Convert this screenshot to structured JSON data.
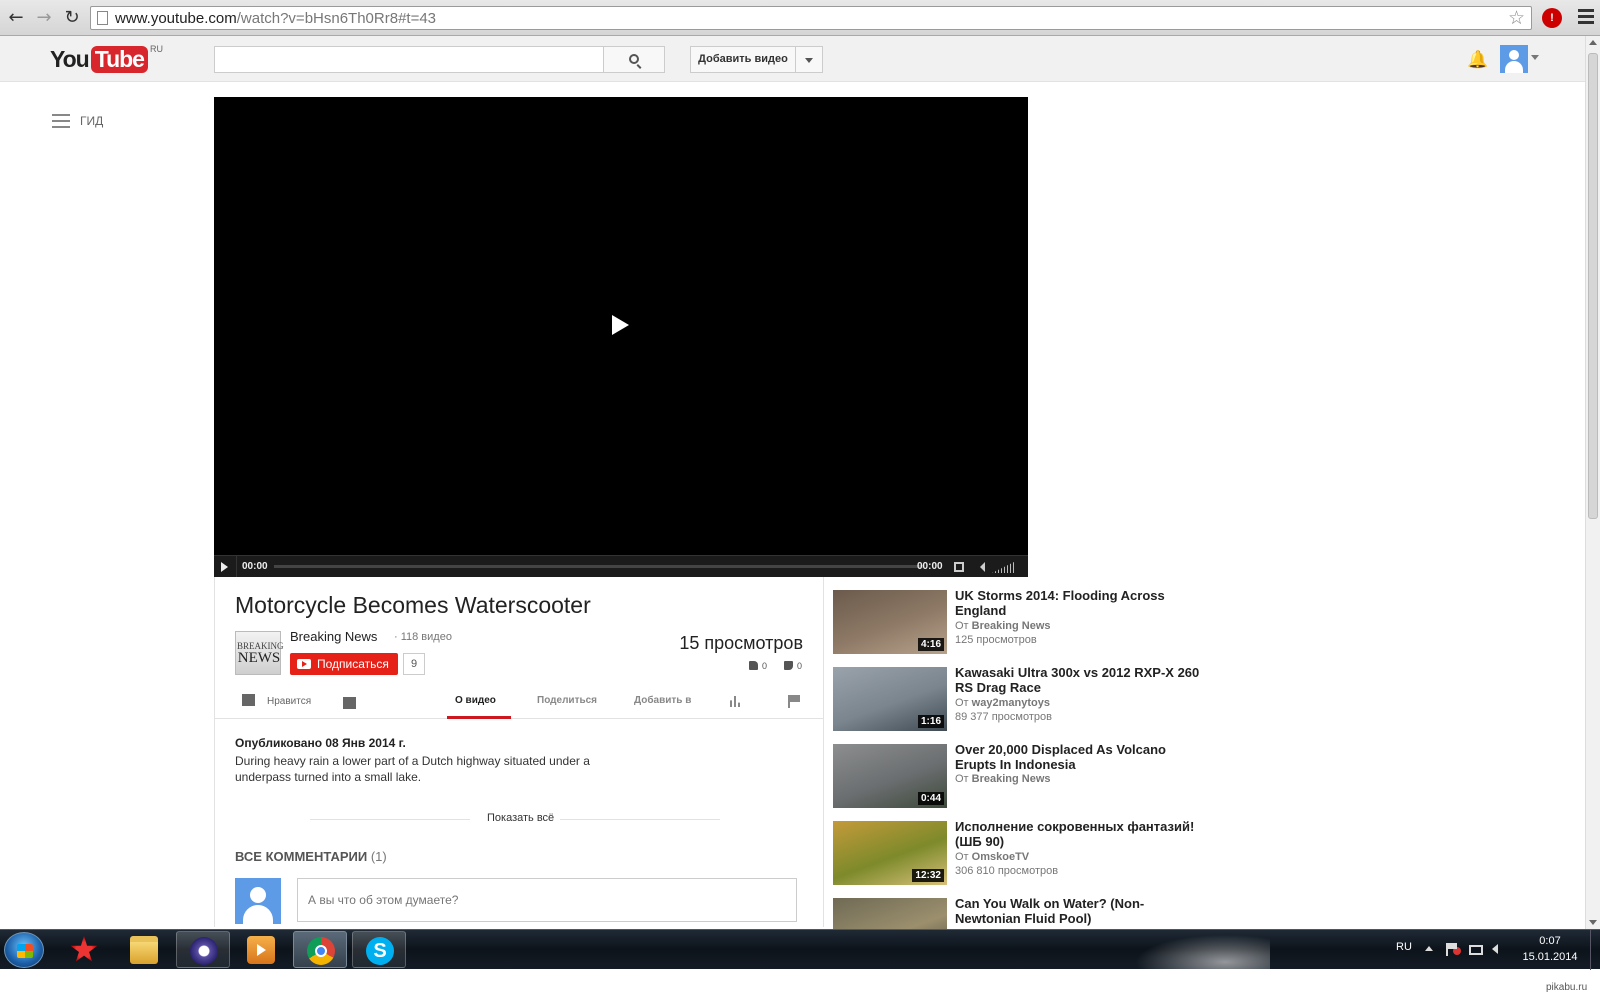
{
  "browser": {
    "url_host": "www.youtube.com",
    "url_rest": "/watch?v=bHsn6Th0Rr8#t=43",
    "back_icon": "arrow-left",
    "forward_icon": "arrow-right",
    "reload_icon": "reload",
    "star_icon": "star-outline",
    "menu_icon": "hamburger"
  },
  "header": {
    "logo_you": "You",
    "logo_tube": "Tube",
    "logo_region": "RU",
    "search_placeholder": "",
    "upload_label": "Добавить видео"
  },
  "guide": {
    "label": "ГИД"
  },
  "player": {
    "time_current": "00:00",
    "time_duration": "00:00",
    "progress": 0
  },
  "video": {
    "title": "Motorcycle Becomes Waterscooter",
    "channel_name": "Breaking News",
    "channel_video_count": "· 118 видео",
    "channel_thumb_line1": "BREAKING",
    "channel_thumb_line2": "NEWS",
    "subscribe_label": "Подписаться",
    "subscriber_count": "9",
    "views": "15 просмотров",
    "likes": "0",
    "dislikes": "0"
  },
  "actions": {
    "like_label": "Нравится",
    "tabs": [
      "О видео",
      "Поделиться",
      "Добавить в"
    ],
    "active_tab": 0
  },
  "description": {
    "published": "Опубликовано 08 Янв 2014 г.",
    "text": "During heavy rain a lower part of a Dutch highway situated under a underpass turned into a small lake.",
    "show_more": "Показать всё"
  },
  "comments": {
    "title": "ВСЕ КОММЕНТАРИИ",
    "count": "(1)",
    "placeholder": "А вы что об этом думаете?"
  },
  "related": [
    {
      "title": "UK Storms 2014: Flooding Across England",
      "author_prefix": "От",
      "author": "Breaking News",
      "views": "125 просмотров",
      "duration": "4:16",
      "thumb_colors": [
        "#6b5a4c",
        "#8e7a66",
        "#b7a38c"
      ]
    },
    {
      "title": "Kawasaki Ultra 300x vs 2012 RXP-X 260 RS Drag Race",
      "author_prefix": "От",
      "author": "way2manytoys",
      "views": "89 377 просмотров",
      "duration": "1:16",
      "thumb_colors": [
        "#9aa3ab",
        "#7b858d",
        "#3f4a52"
      ]
    },
    {
      "title": "Over 20,000 Displaced As Volcano Erupts In Indonesia",
      "author_prefix": "От",
      "author": "Breaking News",
      "views": "",
      "duration": "0:44",
      "thumb_colors": [
        "#8c8e8f",
        "#6b6e70",
        "#3d4a3a"
      ]
    },
    {
      "title": "Исполнение сокровенных фантазий! (ШБ 90)",
      "author_prefix": "От",
      "author": "OmskoeTV",
      "views": "306 810 просмотров",
      "duration": "12:32",
      "thumb_colors": [
        "#c49a3a",
        "#7d8a2b",
        "#d8c07a"
      ]
    },
    {
      "title": "Can You Walk on Water? (Non-Newtonian Fluid Pool)",
      "author_prefix": "",
      "author": "",
      "views": "",
      "duration": "",
      "thumb_colors": [
        "#6f6a55",
        "#9b8f6d",
        "#4a4a3a"
      ]
    }
  ],
  "taskbar": {
    "lang": "RU",
    "time": "0:07",
    "date": "15.01.2014",
    "apps": [
      "start",
      "pokerstars",
      "explorer",
      "utorrent",
      "media-player",
      "chrome",
      "skype"
    ],
    "skype_glyph": "S"
  },
  "watermark": "pikabu.ru"
}
